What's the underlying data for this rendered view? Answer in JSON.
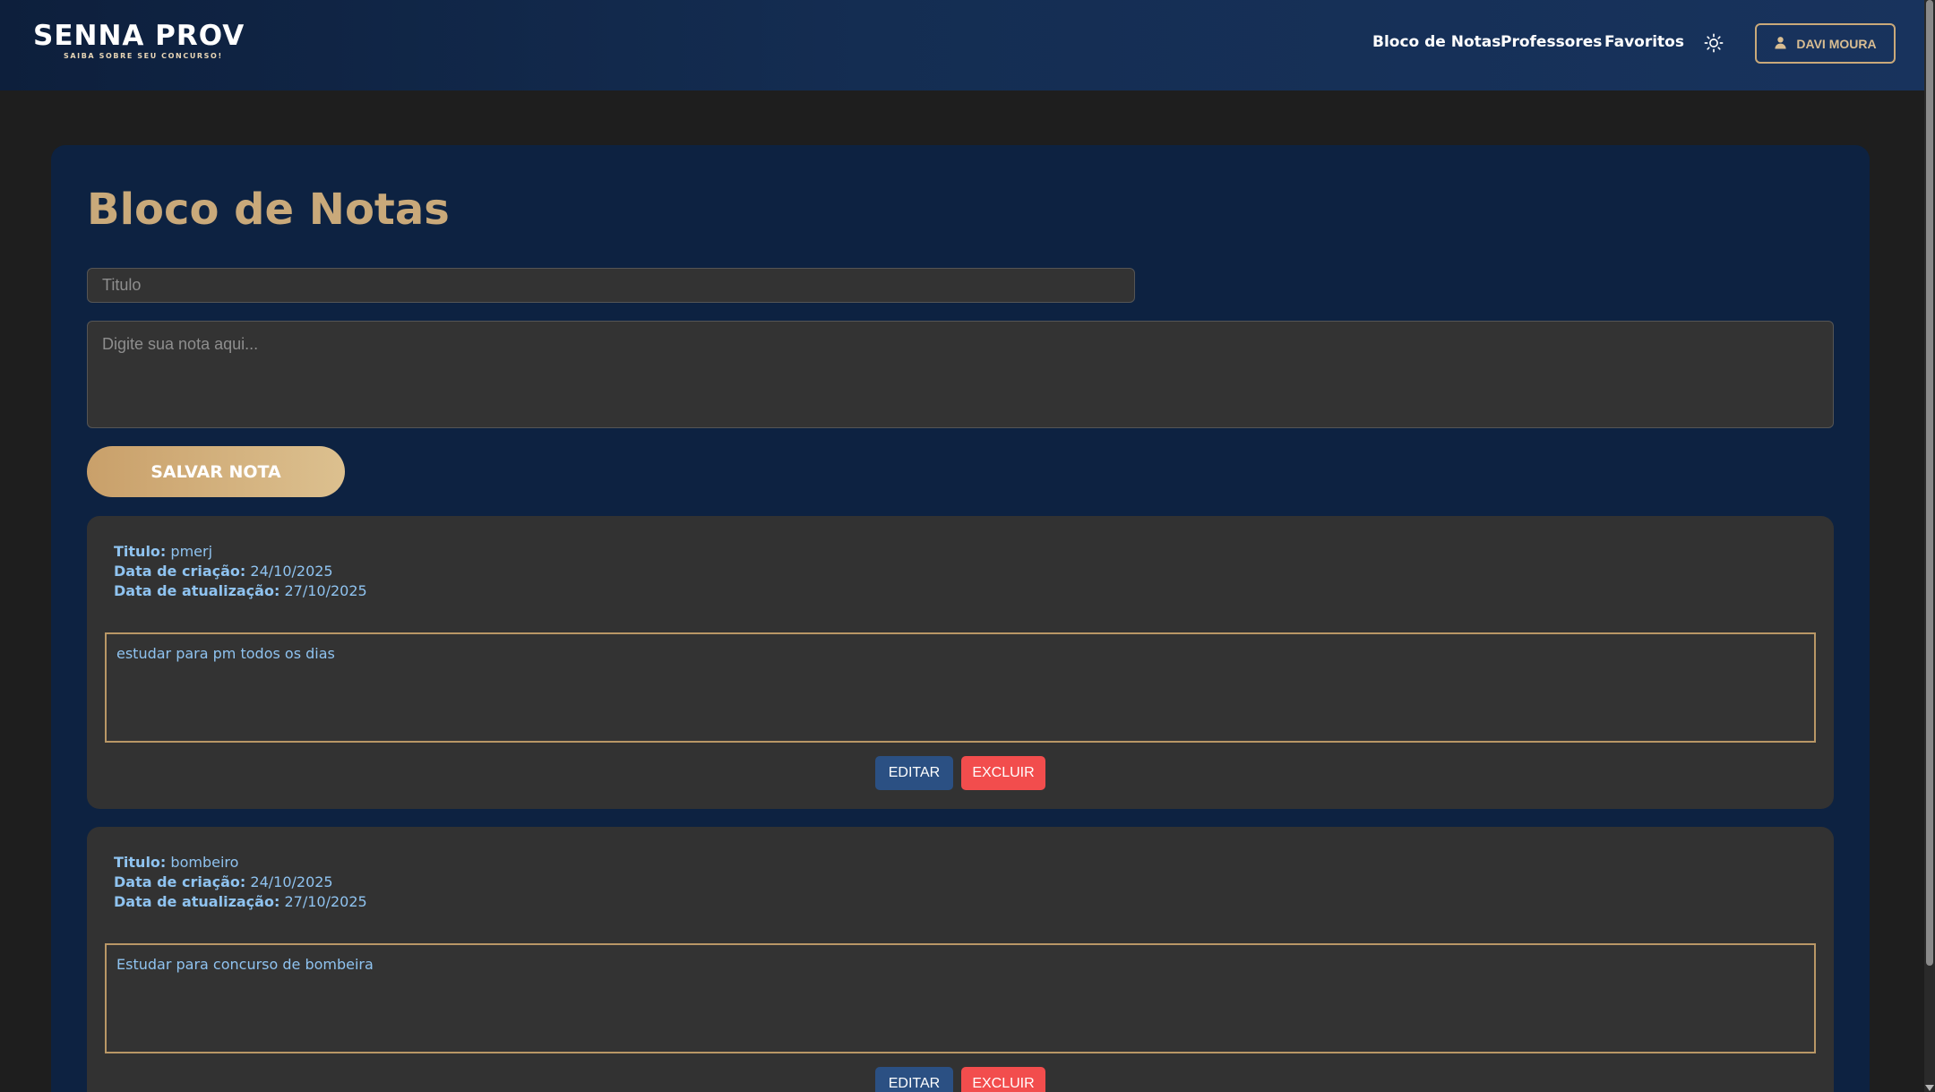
{
  "header": {
    "logo_text": "SENNA PROV",
    "logo_tagline": "SAIBA SOBRE SEU CONCURSO!",
    "nav": [
      {
        "label": "Bloco de Notas"
      },
      {
        "label": "Professores"
      },
      {
        "label": "Favoritos"
      }
    ],
    "theme_icon": "sun-icon",
    "user_label": "DAVI MOURA",
    "user_icon": "user-icon"
  },
  "page": {
    "title": "Bloco de Notas",
    "title_placeholder": "Titulo",
    "note_placeholder": "Digite sua nota aqui...",
    "save_label": "SALVAR NOTA"
  },
  "notes": [
    {
      "title_label": "Titulo:",
      "title": "pmerj",
      "created_label": "Data de criação:",
      "created": "24/10/2025",
      "updated_label": "Data de atualização:",
      "updated": "27/10/2025",
      "body": "estudar para pm todos os dias",
      "edit_label": "EDITAR",
      "delete_label": "EXCLUIR"
    },
    {
      "title_label": "Titulo:",
      "title": "bombeiro",
      "created_label": "Data de criação:",
      "created": "24/10/2025",
      "updated_label": "Data de atualização:",
      "updated": "27/10/2025",
      "body": "Estudar para concurso de bombeira",
      "edit_label": "EDITAR",
      "delete_label": "EXCLUIR"
    }
  ],
  "colors": {
    "accent_gold": "#c9a97a",
    "header_navy": "#142d52",
    "card_navy": "#0d2241",
    "edit_blue": "#2b5083",
    "delete_red": "#f24d4d",
    "note_text": "#8fc3f0"
  }
}
